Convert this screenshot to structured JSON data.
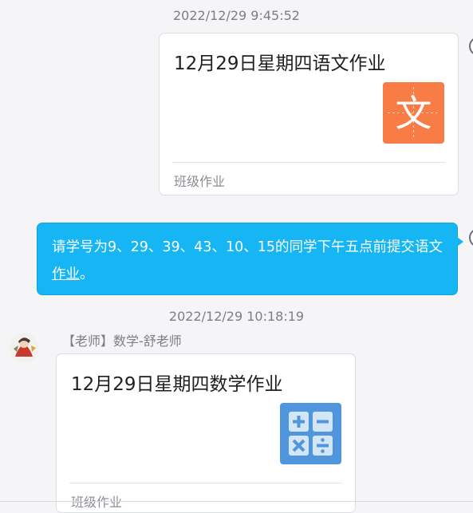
{
  "messages": [
    {
      "timestamp": "2022/12/29 9:45:52",
      "card": {
        "title": "12月29日星期四语文作业",
        "icon": "chinese-subject-icon",
        "icon_glyph": "文",
        "icon_color": "#f87c45",
        "footer": "班级作业"
      }
    },
    {
      "text_before": "请学号为9、29、39、43、10、15的同学下午五点前提交语文",
      "text_link": "作业",
      "text_after": "。",
      "bubble_color": "#16b6f5"
    },
    {
      "timestamp": "2022/12/29 10:18:19",
      "sender": "【老师】数学-舒老师",
      "card": {
        "title": "12月29日星期四数学作业",
        "icon": "math-calculator-icon",
        "icon_color": "#4f96dc",
        "footer": "班级作业"
      }
    }
  ]
}
